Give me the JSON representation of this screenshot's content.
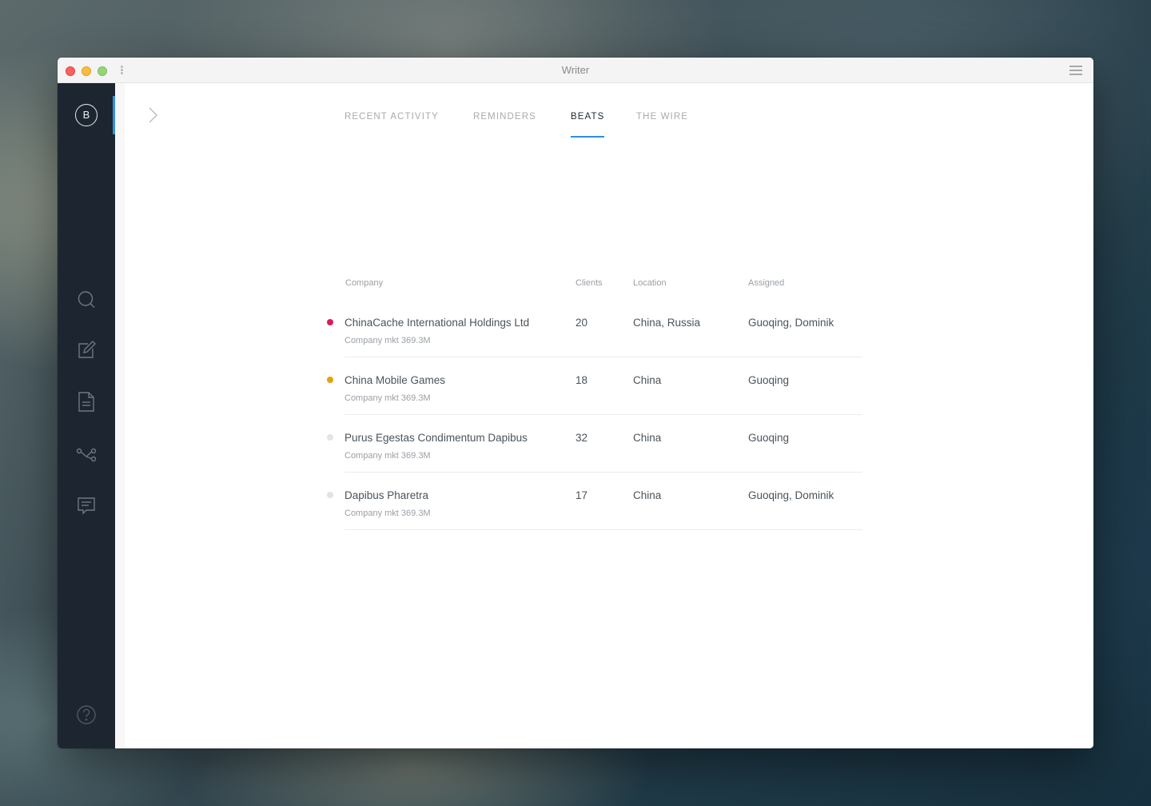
{
  "window": {
    "title": "Writer"
  },
  "sidebar": {
    "brand_letter": "B",
    "items": [
      {
        "icon": "search-icon"
      },
      {
        "icon": "compose-icon"
      },
      {
        "icon": "document-icon"
      },
      {
        "icon": "network-icon"
      },
      {
        "icon": "chat-icon"
      }
    ],
    "help_icon": "help-icon"
  },
  "tabs": [
    {
      "label": "RECENT ACTIVITY",
      "active": false
    },
    {
      "label": "REMINDERS",
      "active": false
    },
    {
      "label": "BEATS",
      "active": true
    },
    {
      "label": "THE WIRE",
      "active": false
    }
  ],
  "table": {
    "headers": {
      "company": "Company",
      "clients": "Clients",
      "location": "Location",
      "assigned": "Assigned"
    },
    "rows": [
      {
        "company": "ChinaCache International Holdings Ltd",
        "sub": "Company mkt 369.3M",
        "clients": "20",
        "location": "China, Russia",
        "assigned": "Guoqing, Dominik",
        "status_color": "#d81b60"
      },
      {
        "company": "China Mobile Games",
        "sub": "Company mkt 369.3M",
        "clients": "18",
        "location": "China",
        "assigned": "Guoqing",
        "status_color": "#e5a10f"
      },
      {
        "company": "Purus Egestas Condimentum Dapibus",
        "sub": "Company mkt 369.3M",
        "clients": "32",
        "location": "China",
        "assigned": "Guoqing",
        "status_color": "#e3e3e3"
      },
      {
        "company": "Dapibus Pharetra",
        "sub": "Company mkt 369.3M",
        "clients": "17",
        "location": "China",
        "assigned": "Guoqing, Dominik",
        "status_color": "#e3e3e3"
      }
    ]
  },
  "colors": {
    "accent": "#2f8fe0",
    "sidebar_bg": "#1d2630"
  }
}
